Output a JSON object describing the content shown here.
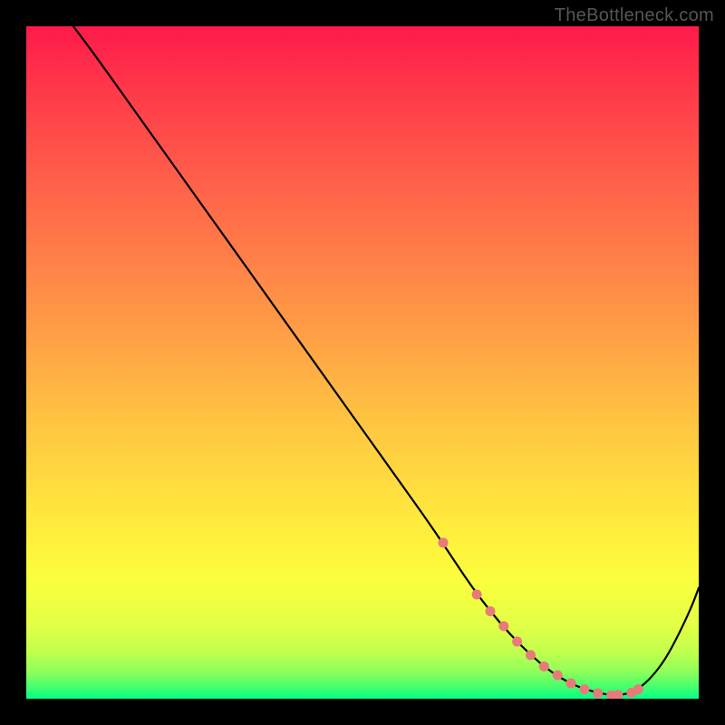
{
  "watermark": "TheBottleneck.com",
  "chart_data": {
    "type": "line",
    "title": "",
    "xlabel": "",
    "ylabel": "",
    "xlim": [
      0,
      100
    ],
    "ylim": [
      0,
      100
    ],
    "curve": {
      "x": [
        7,
        10,
        15,
        20,
        25,
        30,
        35,
        40,
        45,
        50,
        55,
        60,
        63,
        66,
        69,
        72,
        75,
        78,
        81,
        84,
        87,
        89,
        91,
        93,
        95,
        97,
        99,
        100
      ],
      "y": [
        100,
        96,
        89,
        82,
        75,
        68,
        61,
        54,
        47,
        40,
        33,
        26,
        21.5,
        17,
        13,
        9.5,
        6.5,
        4,
        2.2,
        1.1,
        0.5,
        0.6,
        1.4,
        3.2,
        5.8,
        9.5,
        13.8,
        16.5
      ]
    },
    "markers": {
      "x": [
        62,
        67,
        69,
        71,
        73,
        75,
        77,
        79,
        81,
        83,
        85,
        87,
        88,
        90,
        91
      ],
      "y": [
        23.2,
        15.5,
        13,
        10.8,
        8.5,
        6.5,
        4.8,
        3.5,
        2.3,
        1.4,
        0.8,
        0.5,
        0.55,
        0.9,
        1.4
      ]
    },
    "gradient_stops": [
      {
        "offset": 0.0,
        "color": "#ff1a49"
      },
      {
        "offset": 0.1,
        "color": "#ff3a4a"
      },
      {
        "offset": 0.22,
        "color": "#ff5d4a"
      },
      {
        "offset": 0.35,
        "color": "#ff8148"
      },
      {
        "offset": 0.48,
        "color": "#ffa545"
      },
      {
        "offset": 0.58,
        "color": "#ffc242"
      },
      {
        "offset": 0.68,
        "color": "#ffdc3f"
      },
      {
        "offset": 0.76,
        "color": "#fff03d"
      },
      {
        "offset": 0.83,
        "color": "#f9ff3d"
      },
      {
        "offset": 0.89,
        "color": "#e2ff45"
      },
      {
        "offset": 0.93,
        "color": "#c2ff4e"
      },
      {
        "offset": 0.96,
        "color": "#8eff5a"
      },
      {
        "offset": 0.985,
        "color": "#3dff70"
      },
      {
        "offset": 1.0,
        "color": "#00ff88"
      }
    ]
  }
}
